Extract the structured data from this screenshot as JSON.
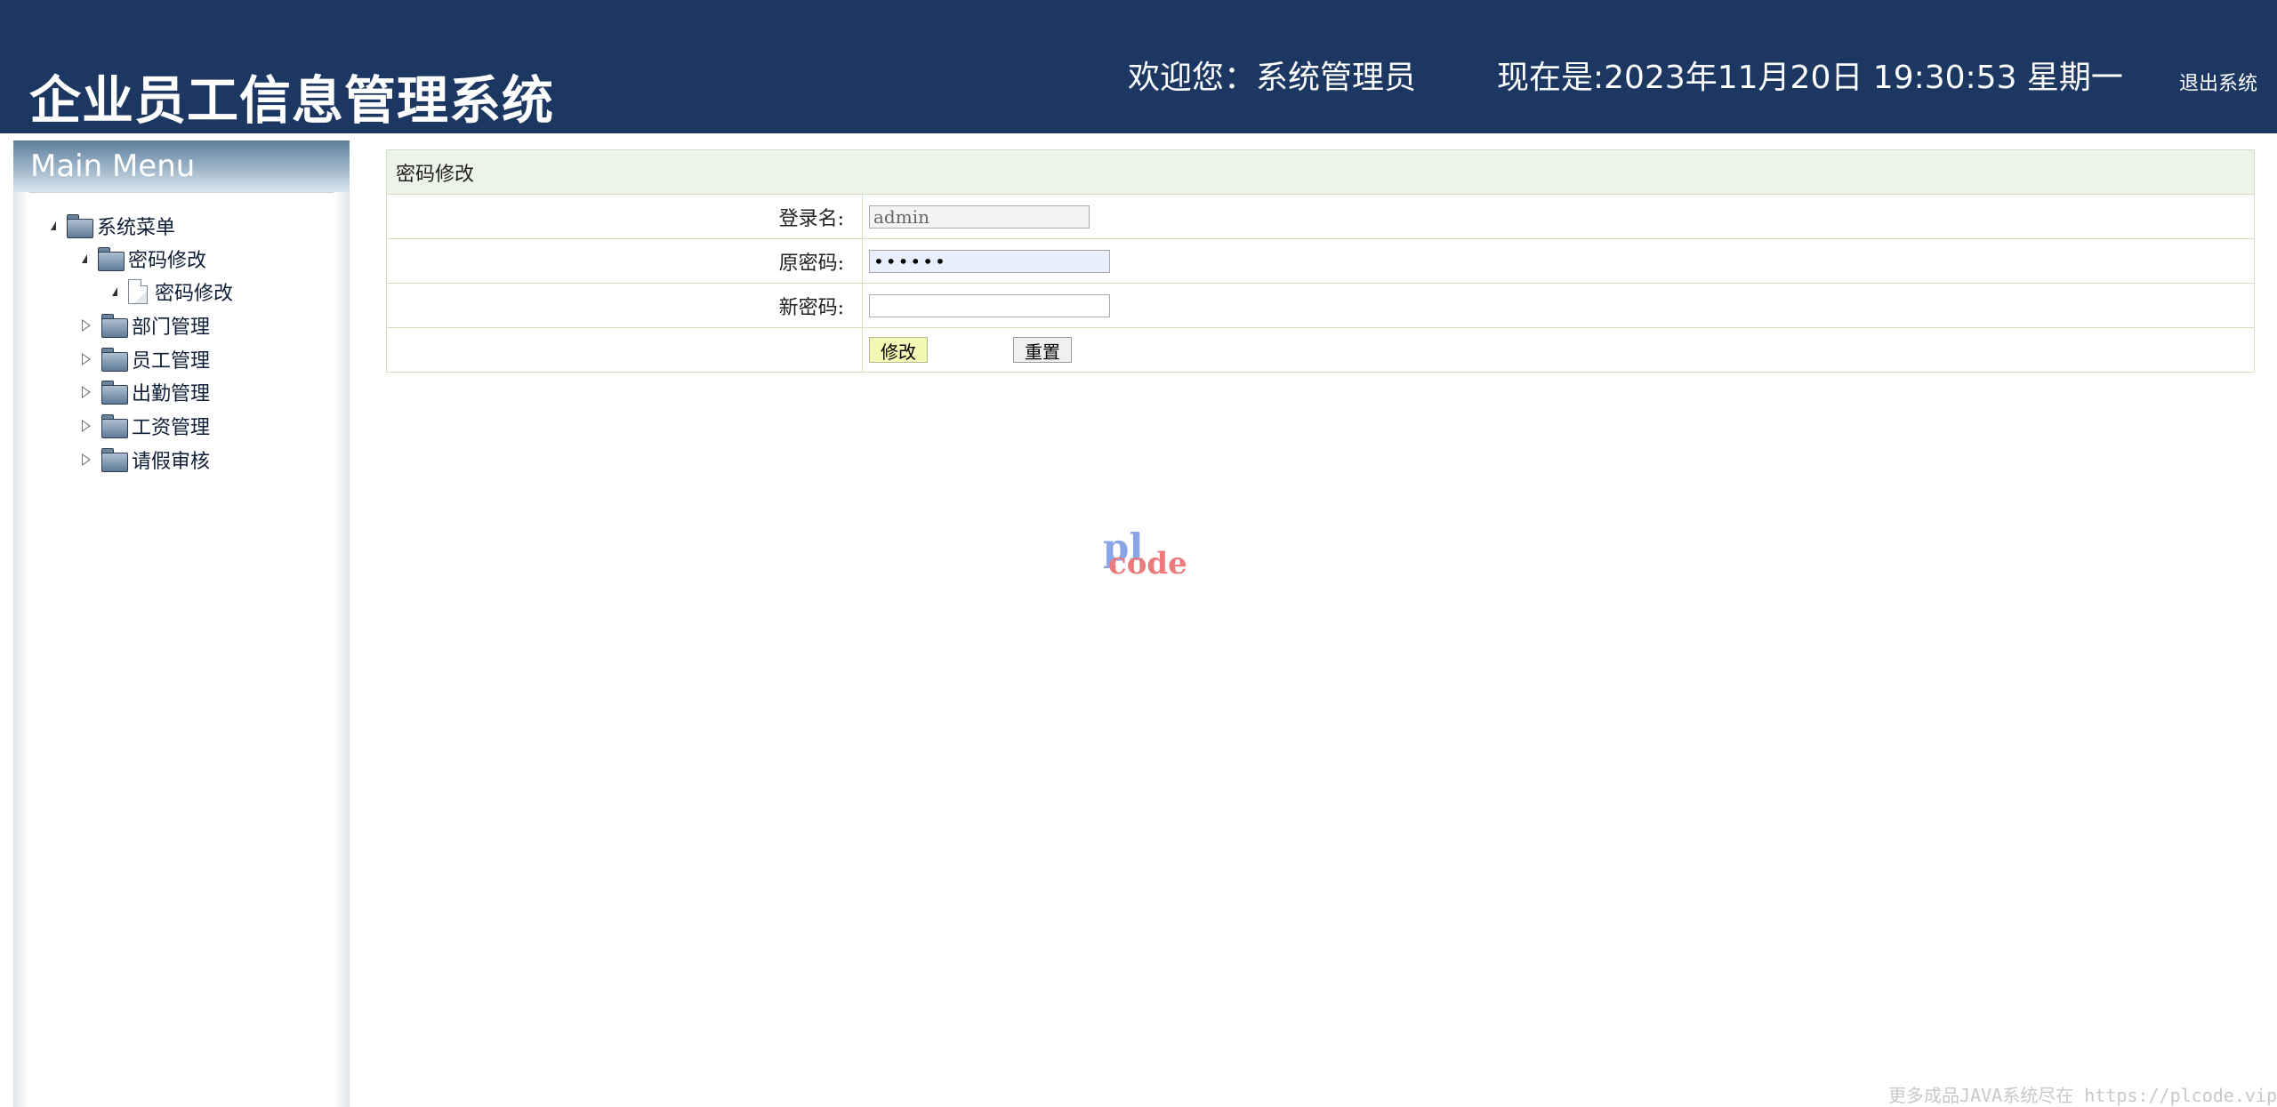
{
  "header": {
    "title": "企业员工信息管理系统",
    "welcome": "欢迎您：系统管理员",
    "now": "现在是:2023年11月20日 19:30:53 星期一",
    "logout": "退出系统"
  },
  "sidebar": {
    "title": "Main Menu",
    "tree": {
      "root": "系统菜单",
      "group_password": "密码修改",
      "leaf_password": "密码修改",
      "dept": "部门管理",
      "employee": "员工管理",
      "attendance": "出勤管理",
      "salary": "工资管理",
      "leave": "请假审核"
    }
  },
  "form": {
    "heading": "密码修改",
    "login_label": "登录名:",
    "login_value": "admin",
    "old_label": "原密码:",
    "old_value": "••••••",
    "new_label": "新密码:",
    "new_value": "",
    "submit_label": "修改",
    "reset_label": "重置"
  },
  "watermark": {
    "logo_top": "pl",
    "logo_bottom": "code",
    "footer": "更多成品JAVA系统尽在 https://plcode.vip"
  },
  "colors": {
    "header_bg": "#1c3762",
    "form_head_bg": "#edf3e6",
    "submit_bg": "#f3f9b4"
  }
}
